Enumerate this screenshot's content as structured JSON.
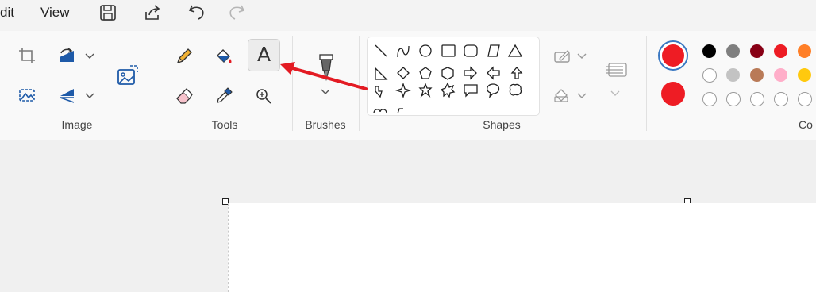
{
  "menubar": {
    "edit_label": "dit",
    "view_label": "View"
  },
  "ribbon": {
    "groups": {
      "image": "Image",
      "tools": "Tools",
      "brushes": "Brushes",
      "shapes": "Shapes",
      "colors": "Co"
    }
  },
  "tools": {
    "text_glyph": "A"
  },
  "colors": {
    "primary": "#ee1c24",
    "secondary": "#ee1c24",
    "palette_row1": [
      "#000000",
      "#7f7f7f",
      "#880015",
      "#ed1c24",
      "#ff7f27"
    ],
    "palette_row2": [
      "#ffffff",
      "#c3c3c3",
      "#b97a57",
      "#ffaec9",
      "#ffc90e"
    ],
    "accent_arrow": "#e31b23"
  },
  "icons": [
    "save-icon",
    "share-icon",
    "undo-icon",
    "redo-icon",
    "crop-icon",
    "rotate-icon",
    "resize-icon",
    "select-icon",
    "flip-icon",
    "pencil-icon",
    "fill-icon",
    "text-icon",
    "eraser-icon",
    "color-picker-icon",
    "magnifier-icon",
    "brush-icon",
    "outline-icon",
    "shape-fill-icon",
    "layers-icon"
  ]
}
